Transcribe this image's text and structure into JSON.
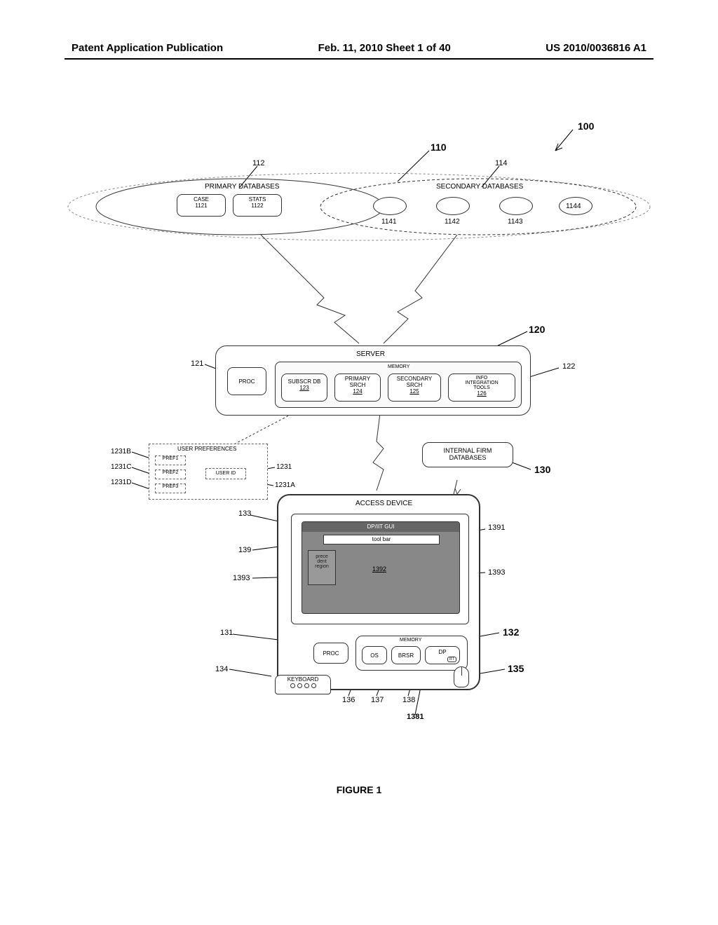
{
  "header": {
    "left": "Patent Application Publication",
    "center": "Feb. 11, 2010  Sheet 1 of 40",
    "right": "US 2010/0036816 A1"
  },
  "figure_caption": "FIGURE 1",
  "refs": {
    "r100": "100",
    "r110": "110",
    "r112": "112",
    "r114": "114",
    "r1121": "1121",
    "r1122": "1122",
    "r1141": "1141",
    "r1142": "1142",
    "r1143": "1143",
    "r1144": "1144",
    "r120": "120",
    "r121": "121",
    "r122": "122",
    "r123": "123",
    "r124": "124",
    "r125": "125",
    "r126": "126",
    "r1231": "1231",
    "r1231A": "1231A",
    "r1231B": "1231B",
    "r1231C": "1231C",
    "r1231D": "1231D",
    "r130": "130",
    "r131": "131",
    "r132": "132",
    "r133": "133",
    "r134": "134",
    "r135": "135",
    "r136": "136",
    "r137": "137",
    "r138": "138",
    "r139": "139",
    "r1381": "1381",
    "r1391": "1391",
    "r1392": "1392",
    "r1393_left": "1393",
    "r1393_right": "1393"
  },
  "labels": {
    "primary_db": "PRIMARY DATABASES",
    "secondary_db": "SECONDARY DATABASES",
    "case": "CASE",
    "stats": "STATS",
    "server": "SERVER",
    "memory": "MEMORY",
    "proc": "PROC",
    "subscr_db": "SUBSCR DB",
    "primary_srch": "PRIMARY\nSRCH",
    "secondary_srch": "SECONDARY\nSRCH",
    "info_tools": "INFO\nINTEGRATION\nTOOLS",
    "user_prefs": "USER PREFERENCES",
    "pref1": "PREF1",
    "pref2": "PREF2",
    "pref3": "PREF3",
    "user_id": "USER ID",
    "internal_firm": "INTERNAL FIRM\nDATABASES",
    "access_device": "ACCESS DEVICE",
    "dp_iit_gui": "DP/IIT GUI",
    "toolbar": "tool bar",
    "precedent": "prece\ndent\nregion",
    "os": "OS",
    "brsr": "BRSR",
    "dp_iit": "DP",
    "dp_iit_sub": "IIT",
    "keyboard": "KEYBOARD"
  }
}
